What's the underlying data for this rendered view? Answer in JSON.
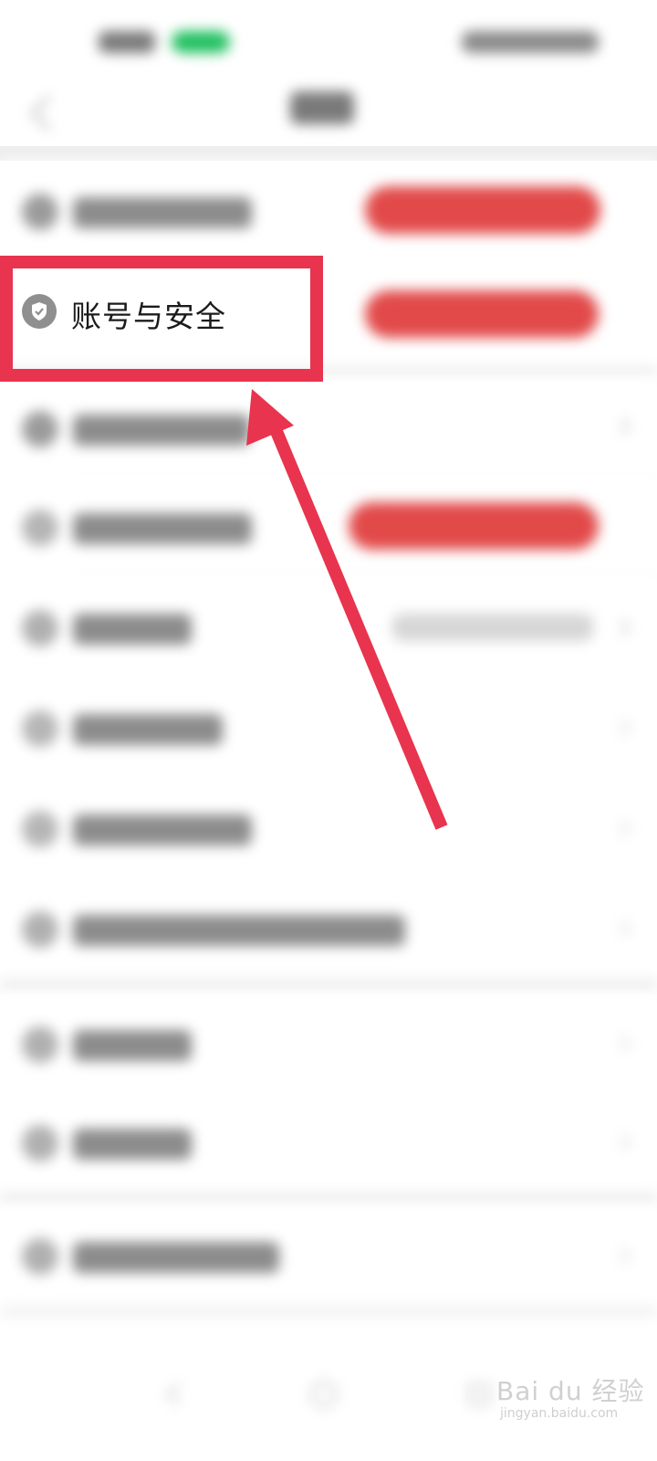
{
  "focused_item": {
    "label": "账号与安全",
    "icon": "shield-check-icon"
  },
  "annotation": {
    "highlight_color": "#e8344e",
    "arrow_color": "#e8344e"
  },
  "watermark": {
    "brand": "Bai du 经验",
    "url": "jingyan.baidu.com"
  },
  "colors": {
    "badge_red": "#e24a4a",
    "status_green": "#20c060"
  }
}
